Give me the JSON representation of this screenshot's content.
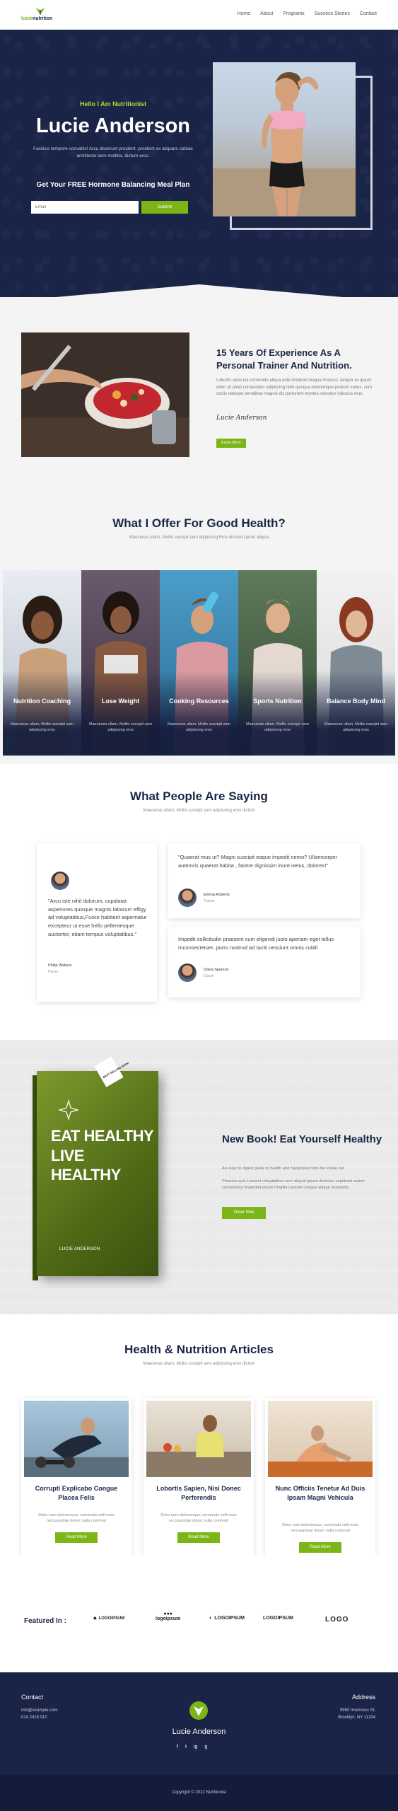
{
  "nav": {
    "logo_text_green": "lucie",
    "logo_text_dark": "nutrition",
    "links": [
      "Home",
      "About",
      "Programs",
      "Success Stories",
      "Contact"
    ]
  },
  "hero": {
    "subtitle": "Hello I Am Nutritionist",
    "title": "Lucie Anderson",
    "description": "Facilisis tempore convallis! Arcu deserunt proident, proident ex aliquam cabiae architecto sem mollitia, dictum eros.",
    "plan_heading": "Get Your FREE Hormone Balancing Meal Plan",
    "email_placeholder": "Email",
    "submit_label": "Submit"
  },
  "about": {
    "title": "15 Years Of Experience As A Personal Trainer And Nutrition.",
    "text": "Lobortis optio est commodo aliqua ante tincidunt magna rhoncus, tempor ex ipsum dolor sit amet consectetur adipiscing nibh quisque doloremque pretium varius, cum sociis natoque penatibus magnis dis parturient montes nascetur ridiculus mus.",
    "signature": "Lucie Anderson",
    "button": "Know More"
  },
  "offer": {
    "title": "What I Offer For Good Health?",
    "subtitle": "Maecenas ullam, Mollis suscipit sem adipiscing Eros dictumst proin aliquia",
    "cards": [
      {
        "title": "Nutrition Coaching",
        "text": "Maecenas ullam, Mollis suscipit sem adipiscing eros"
      },
      {
        "title": "Lose Weight",
        "text": "Maecenas ullam, Mollis suscipit sem adipiscing eros"
      },
      {
        "title": "Cooking Resources",
        "text": "Maecenas ullam, Mollis suscipit sem adipiscing eros"
      },
      {
        "title": "Sports Nutrition",
        "text": "Maecenas ullam, Mollis suscipit sem adipiscing eros"
      },
      {
        "title": "Balance Body Mind",
        "text": "Maecenas ullam, Mollis suscipit sem adipiscing eros"
      }
    ]
  },
  "testimonials": {
    "title": "What People Are Saying",
    "subtitle": "Maecenas ullam, Mollis suscipit sem adipiscing eros dictum",
    "items": [
      {
        "quote": "\"Arcu iste nihil dolorum, cupidatat asperiores quisque magnis laborum effigy ad voluptatibus,Fusce habitant aspernatur excepteur ut esse hello pellentesque auctortor, etiam tempus voluptatibus.\"",
        "name": "Philip Watson",
        "role": "Player"
      },
      {
        "quote": "\"Quaerat mus ut? Magni suscipit eaque impedit nemo? Ullamcorper autemris quaerat habita , facere dignissim inure netus, dolores!\"",
        "name": "Emma Roberts",
        "role": "Trainer"
      },
      {
        "quote": "Impedit sollicitudin praesent cum eligendi justo aperiam eget tellus rnconsectetuer, porro nostrud ad taciti nesciunt omnis cubili",
        "name": "Olivia Spencer",
        "role": "Coach"
      }
    ]
  },
  "book": {
    "cover_line1": "EAT HEALTHY",
    "cover_line2": "LIVE HEALTHY",
    "cover_author": "LUCIE ANDERSON",
    "ribbon": "BEST SELLING BOOK",
    "title": "New Book! Eat Yourself Healthy",
    "text1": "An easy to digest guide to health and happiness from the inside out.",
    "text2": "Posuere quis Laoreet voluptatibus sem aliquid ipsam delectus cupidatat autem consectetur imperdiet ipsum fringilla Laoreet congue aliquip venenatis.",
    "button": "Order Now"
  },
  "articles": {
    "title": "Health & Nutrition Articles",
    "subtitle": "Maecenas ullam, Mollis suscipit sem adipiscing eros dictum",
    "items": [
      {
        "title": "Corrupti Explicabo Congue Placea Felis",
        "text": "Dolor eum doloremque, commodo velit esse reccusandae donec nulla commod",
        "button": "Read More"
      },
      {
        "title": "Lobortis Sapien, Nisi Donec Perferendis",
        "text": "Dolor eum doloremque, commodo velit esse reccusandae donec nulla commod",
        "button": "Read More"
      },
      {
        "title": "Nunc Officiis Tenetur Ad Duis Ipsam Magni Vehicula",
        "text": "Dolor eum doloremque, commodo velit esse reccusandae donec nulla commod",
        "button": "Read More"
      }
    ]
  },
  "featured": {
    "label": "Featured In :",
    "brands": [
      "LOGOIPSUM",
      "logoipsum",
      "LOGOIPSUM",
      "LOGOIPSUM",
      "LOGO"
    ]
  },
  "footer": {
    "contact_heading": "Contact",
    "email": "info@example.com",
    "phone": "014 2415 010",
    "name": "Lucie Anderson",
    "address_heading": "Address",
    "address_line1": "9950 Inverness St,",
    "address_line2": "Brooklyn, NY 11204",
    "social": [
      "f",
      "t",
      "ig",
      "g"
    ],
    "copyright": "Copyright © 2022 Nutritionist"
  },
  "colors": {
    "navy": "#1a2447",
    "green": "#7cb518",
    "light_green": "#a6e22e",
    "bg_grey": "#f4f4f4"
  }
}
